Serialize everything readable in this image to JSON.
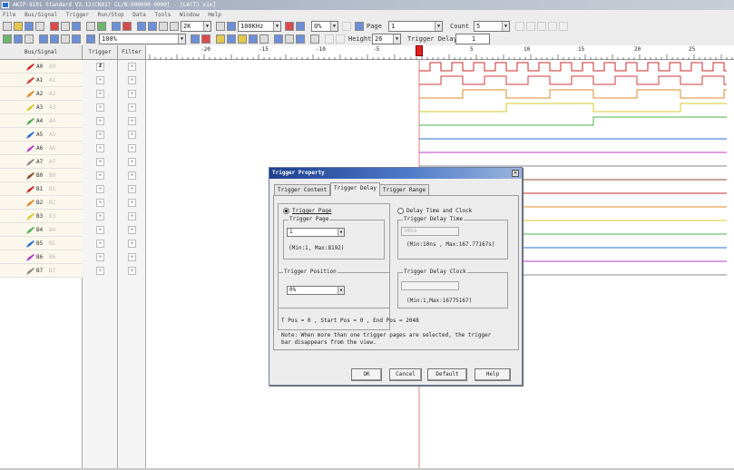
{
  "window": {
    "title": "AKIP-9101 Standard V3.12(CN01) CL/N:000000-0000] - [LA(T) x1x]"
  },
  "menu": [
    "File",
    "Bus/Signal",
    "Trigger",
    "Run/Stop",
    "Data",
    "Tools",
    "Window",
    "Help"
  ],
  "toolbar1": {
    "sample_count": "2K",
    "frequency": "100KHz",
    "percent": "0%",
    "page_label": "Page",
    "page_value": "1",
    "count_label": "Count",
    "count_value": "5"
  },
  "toolbar2": {
    "zoom": "100%",
    "height_label": "Height",
    "height_value": "26",
    "trigger_delay_label": "Trigger Delay",
    "trigger_delay_value": "1"
  },
  "headers": {
    "bus_signal": "Bus/Signal",
    "trigger": "Trigger",
    "filter": "Filter"
  },
  "ruler_ticks": [
    "-20",
    "-15",
    "-10",
    "-5",
    "0",
    "5",
    "10",
    "15",
    "20",
    "25"
  ],
  "signals": [
    {
      "name": "A0",
      "alias": "A0",
      "color": "#cc2a2a"
    },
    {
      "name": "A1",
      "alias": "A1",
      "color": "#d23b3b"
    },
    {
      "name": "A2",
      "alias": "A2",
      "color": "#e08a2a"
    },
    {
      "name": "A3",
      "alias": "A3",
      "color": "#d9c92a"
    },
    {
      "name": "A4",
      "alias": "A4",
      "color": "#4cb04c"
    },
    {
      "name": "A5",
      "alias": "A5",
      "color": "#2a6fd1"
    },
    {
      "name": "A6",
      "alias": "A6",
      "color": "#b83fc8"
    },
    {
      "name": "A7",
      "alias": "A7",
      "color": "#8a8a8a"
    },
    {
      "name": "B0",
      "alias": "B0",
      "color": "#8a4a2a"
    },
    {
      "name": "B1",
      "alias": "B1",
      "color": "#cc2a2a"
    },
    {
      "name": "B2",
      "alias": "B2",
      "color": "#e08a2a"
    },
    {
      "name": "B3",
      "alias": "B3",
      "color": "#d9c92a"
    },
    {
      "name": "B4",
      "alias": "B4",
      "color": "#4cb04c"
    },
    {
      "name": "B5",
      "alias": "B5",
      "color": "#2a6fd1"
    },
    {
      "name": "B6",
      "alias": "B6",
      "color": "#b83fc8"
    },
    {
      "name": "B7",
      "alias": "B7",
      "color": "#8a8a8a"
    }
  ],
  "a0_trigger_symbol": "Z",
  "dialog": {
    "title": "Trigger Property",
    "tabs": [
      "Trigger Content",
      "Trigger Delay",
      "Trigger Range"
    ],
    "active_tab": "Trigger Delay",
    "trigger_page_radio": "Trigger Page",
    "trigger_page_group": "Trigger Page",
    "trigger_page_value": "1",
    "trigger_page_range": "(Min:1, Max:8192)",
    "delay_time_clock_radio": "Delay Time and Clock",
    "delay_time_group": "Trigger Delay Time",
    "delay_time_value": "10ns",
    "delay_time_range": "(Min:10ns , Max:167.77167s)",
    "trigger_position_group": "Trigger Position",
    "trigger_position_value": "0%",
    "delay_clock_group": "Trigger Delay Clock",
    "delay_clock_value": "",
    "delay_clock_range": "(Min:1,Max:16775167)",
    "positions_text": "T Pos = 0 ,  Start Pos = 0 ,  End Pos = 2048",
    "note_line1": "Note: When more than one trigger pages are selected, the trigger",
    "note_line2": "bar disappears from the view.",
    "buttons": {
      "ok": "OK",
      "cancel": "Cancel",
      "default": "Default",
      "help": "Help"
    }
  }
}
